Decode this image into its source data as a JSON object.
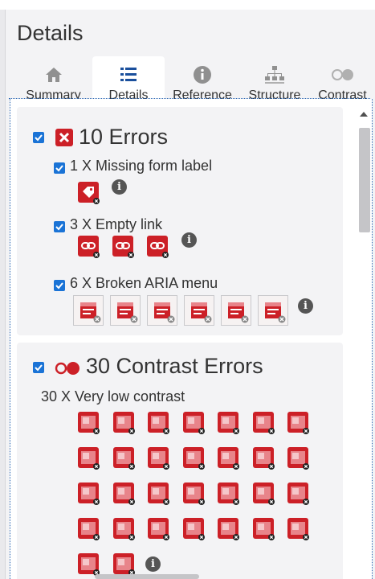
{
  "panel": {
    "title": "Details"
  },
  "tabs": [
    {
      "label": "Summary",
      "icon": "home-icon",
      "active": false
    },
    {
      "label": "Details",
      "icon": "list-icon",
      "active": true
    },
    {
      "label": "Reference",
      "icon": "info-icon",
      "active": false
    },
    {
      "label": "Structure",
      "icon": "sitemap-icon",
      "active": false
    },
    {
      "label": "Contrast",
      "icon": "contrast-icon",
      "active": false
    }
  ],
  "errors_group": {
    "title": "10 Errors",
    "items": [
      {
        "label": "1 X Missing form label",
        "count": 1,
        "icon": "missing-form-label-icon"
      },
      {
        "label": "3 X Empty link",
        "count": 3,
        "icon": "empty-link-icon"
      },
      {
        "label": "6 X Broken ARIA menu",
        "count": 6,
        "icon": "broken-aria-menu-icon"
      }
    ]
  },
  "contrast_group": {
    "title": "30 Contrast Errors",
    "items": [
      {
        "label": "30 X Very low contrast",
        "count": 30,
        "icon": "very-low-contrast-icon"
      }
    ]
  },
  "colors": {
    "error_red": "#cc2027",
    "checkbox_blue": "#1a73d6",
    "focus_blue": "#2d68b4"
  }
}
